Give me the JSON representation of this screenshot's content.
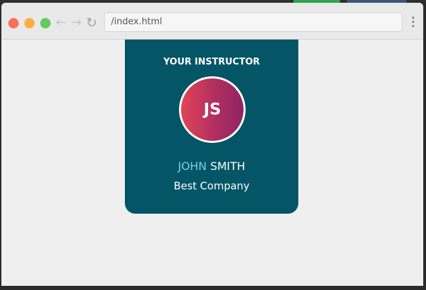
{
  "browser": {
    "url": "/index.html",
    "icons": {
      "back": "arrow-left-icon",
      "forward": "arrow-right-icon",
      "reload": "reload-icon",
      "menu": "more-vertical-icon"
    },
    "traffic_lights": {
      "close": "#fb6f5b",
      "minimize": "#fbb040",
      "maximize": "#63cb5a"
    }
  },
  "card": {
    "heading": "YOUR INSTRUCTOR",
    "avatar_initials": "JS",
    "first_name": "JOHN",
    "last_name": "SMITH",
    "company": "Best Company",
    "colors": {
      "card_background": "#045566",
      "first_name": "#7fcfe0",
      "avatar_gradient_start": "#e04458",
      "avatar_gradient_end": "#8f2366"
    }
  }
}
